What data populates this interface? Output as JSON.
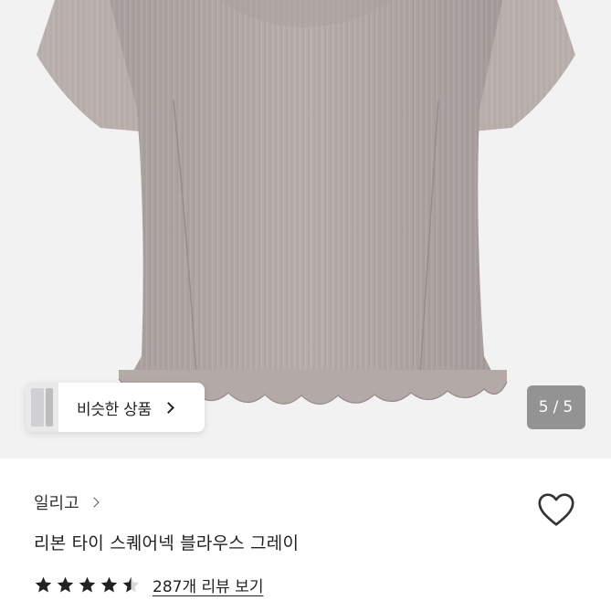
{
  "gallery": {
    "similar_button_label": "비슷한 상품",
    "current_page": "5",
    "total_pages": "5",
    "counter_separator": "/"
  },
  "product": {
    "brand": "일리고",
    "title": "리본 타이 스퀘어넥 블라우스 그레이",
    "rating": 4.5,
    "review_count_label": "287개 리뷰 보기"
  },
  "colors": {
    "blouse": "#b7aeac",
    "image_bg": "#f3f2f2",
    "star": "#222222",
    "counter_bg": "#7a7a7c"
  },
  "icons": {
    "like": "heart-outline-icon",
    "star": "star-icon",
    "chevron": "chevron-right-icon"
  }
}
